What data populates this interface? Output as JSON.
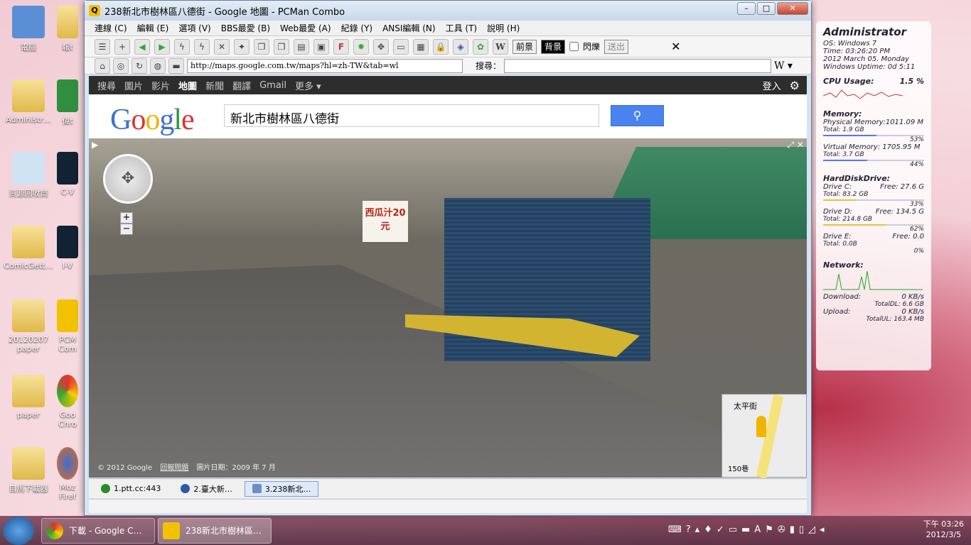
{
  "desktop": {
    "icons": [
      "電腦",
      "報t",
      "Administr…",
      "偉t",
      "資源回收筒",
      "C-V",
      "ComicGett…",
      "I-V",
      "20120207 paper",
      "PCM Com",
      "paper",
      "Goo Chro",
      "自馬下載器",
      "Moz Firef"
    ]
  },
  "window": {
    "title": "238新北市樹林區八德街 - Google 地圖 - PCMan Combo",
    "menu": [
      "連線 (C)",
      "編輯 (E)",
      "選項 (V)",
      "BBS最愛 (B)",
      "Web最愛 (A)",
      "紀錄 (Y)",
      "ANSI編輯 (N)",
      "工具 (T)",
      "說明 (H)"
    ],
    "toolbar": {
      "fg_label": "前景",
      "bg_label": "背景",
      "blink_label": "閃爍",
      "send_label": "送出"
    },
    "address": "http://maps.google.com.tw/maps?hl=zh-TW&tab=wl",
    "search_label": "搜尋："
  },
  "google": {
    "nav": [
      "搜尋",
      "圖片",
      "影片",
      "地圖",
      "新聞",
      "翻譯",
      "Gmail",
      "更多 ▾"
    ],
    "login": "登入",
    "logo": "Google",
    "query": "新北市樹林區八德街",
    "copyright": "© 2012 Google",
    "report": "回報問題",
    "date": "圖片日期：2009 年 7 月",
    "sign": "西瓜汁20元",
    "map_street": "太平街",
    "map_lane": "150巷"
  },
  "tabs": [
    {
      "label": "1.ptt.cc:443",
      "color": "#2a8a2a"
    },
    {
      "label": "2.臺大新…",
      "color": "#2a5aa8"
    },
    {
      "label": "3.238新北…",
      "color": "#6b8fc9"
    }
  ],
  "widget": {
    "user": "Administrator",
    "os": "OS: Windows 7",
    "time": "Time: 03:26:20 PM",
    "date": "2012 March 05. Monday",
    "uptime": "Windows Uptime: 0d 5:11",
    "cpu": "CPU Usage:",
    "cpu_val": "1.5 %",
    "mem": "Memory:",
    "phys": "Physical Memory:1011.09 M",
    "phys_total": "Total: 1.9 GB",
    "phys_pct": "53%",
    "virt": "Virtual Memory: 1705.95 M",
    "virt_total": "Total: 3.7 GB",
    "virt_pct": "44%",
    "hdd": "HardDiskDrive:",
    "c": "Drive C:",
    "c_free": "Free: 27.6 G",
    "c_total": "Total: 83.2 GB",
    "c_pct": "33%",
    "d": "Drive D:",
    "d_free": "Free: 134.5 G",
    "d_total": "Total: 214.8 GB",
    "d_pct": "62%",
    "e": "Drive E:",
    "e_free": "Free: 0.0",
    "e_total": "Total: 0.0B",
    "e_pct": "0%",
    "net": "Network:",
    "down": "Download:",
    "down_val": "0 KB/s",
    "down_total": "TotalDL: 6.6 GB",
    "up": "Upload:",
    "up_val": "0 KB/s",
    "up_total": "TotalUL: 163.4 MB"
  },
  "taskbar": {
    "items": [
      "下載 - Google C…",
      "238新北市樹林區…"
    ],
    "time": "下午 03:26",
    "date": "2012/3/5"
  }
}
